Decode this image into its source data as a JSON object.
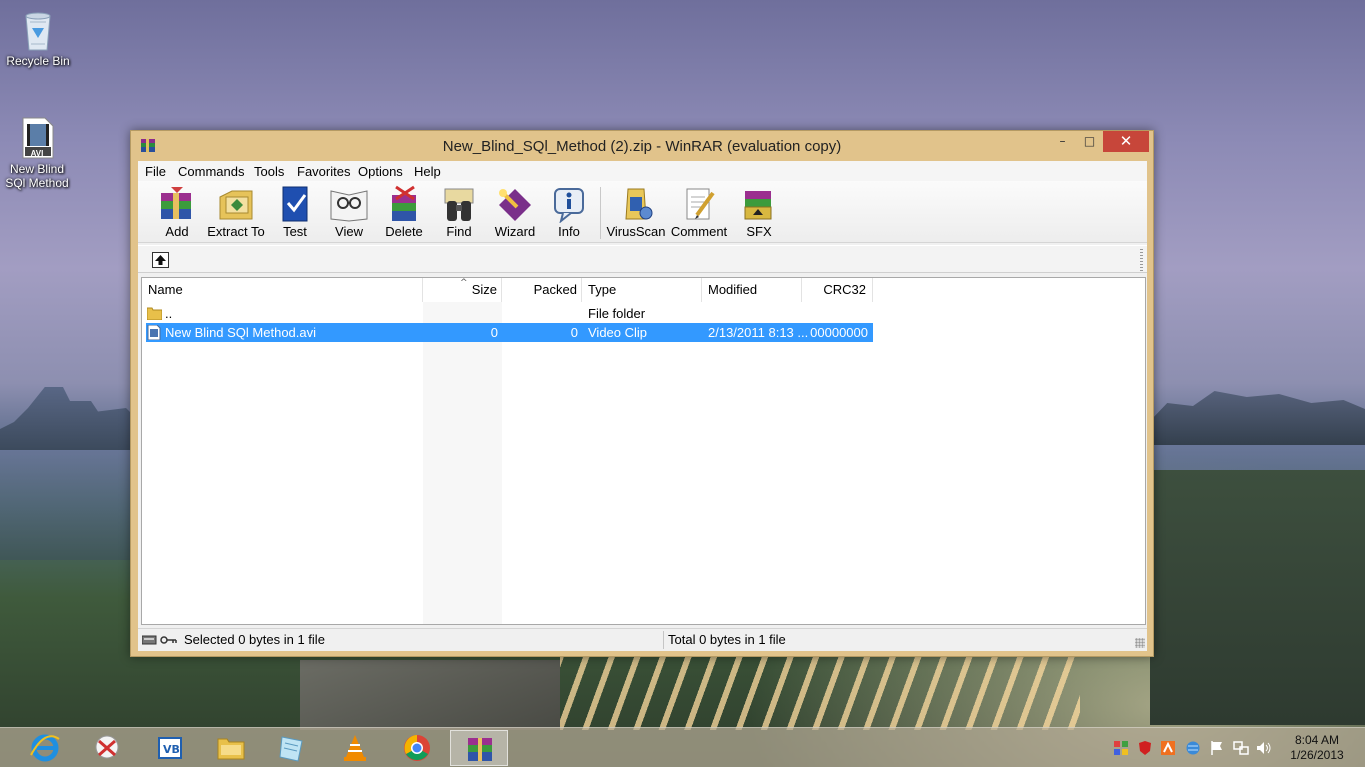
{
  "desktop": {
    "icons": [
      {
        "label": "Recycle Bin"
      },
      {
        "label": "New Blind SQl Method",
        "badge": "AVI"
      }
    ]
  },
  "window": {
    "title": "New_Blind_SQl_Method (2).zip - WinRAR (evaluation copy)",
    "controls": {
      "minimize": "–",
      "maximize": "□",
      "close": "✕"
    }
  },
  "menu": [
    "File",
    "Commands",
    "Tools",
    "Favorites",
    "Options",
    "Help"
  ],
  "toolbar": [
    {
      "label": "Add",
      "icon": "add-archive-icon"
    },
    {
      "label": "Extract To",
      "icon": "extract-to-icon"
    },
    {
      "label": "Test",
      "icon": "test-icon"
    },
    {
      "label": "View",
      "icon": "view-icon"
    },
    {
      "label": "Delete",
      "icon": "delete-icon"
    },
    {
      "label": "Find",
      "icon": "find-binoculars-icon"
    },
    {
      "label": "Wizard",
      "icon": "wizard-icon"
    },
    {
      "label": "Info",
      "icon": "info-icon"
    },
    {
      "label": "VirusScan",
      "icon": "virusscan-icon"
    },
    {
      "label": "Comment",
      "icon": "comment-icon"
    },
    {
      "label": "SFX",
      "icon": "sfx-icon"
    }
  ],
  "filelist": {
    "columns": [
      "Name",
      "Size",
      "Packed",
      "Type",
      "Modified",
      "CRC32"
    ],
    "sort_indicator": "^",
    "rows": [
      {
        "name": "..",
        "size": "",
        "packed": "",
        "type": "File folder",
        "modified": "",
        "crc": "",
        "icon": "folder-icon",
        "selected": false
      },
      {
        "name": "New Blind SQl Method.avi",
        "size": "0",
        "packed": "0",
        "type": "Video Clip",
        "modified": "2/13/2011 8:13 ...",
        "crc": "00000000",
        "icon": "video-file-icon",
        "selected": true
      }
    ]
  },
  "status": {
    "left": "Selected 0 bytes in 1 file",
    "right": "Total 0 bytes in 1 file"
  },
  "taskbar": {
    "apps": [
      "internet-explorer-icon",
      "snipping-tool-icon",
      "virtualbox-icon",
      "file-explorer-icon",
      "notepad-icon",
      "vlc-icon",
      "chrome-icon",
      "winrar-icon"
    ],
    "active_index": 7,
    "clock_time": "8:04 AM",
    "clock_date": "1/26/2013"
  },
  "colors": {
    "selection": "#3399ff",
    "close_button": "#c7463a",
    "window_frame": "#e1c38b"
  }
}
